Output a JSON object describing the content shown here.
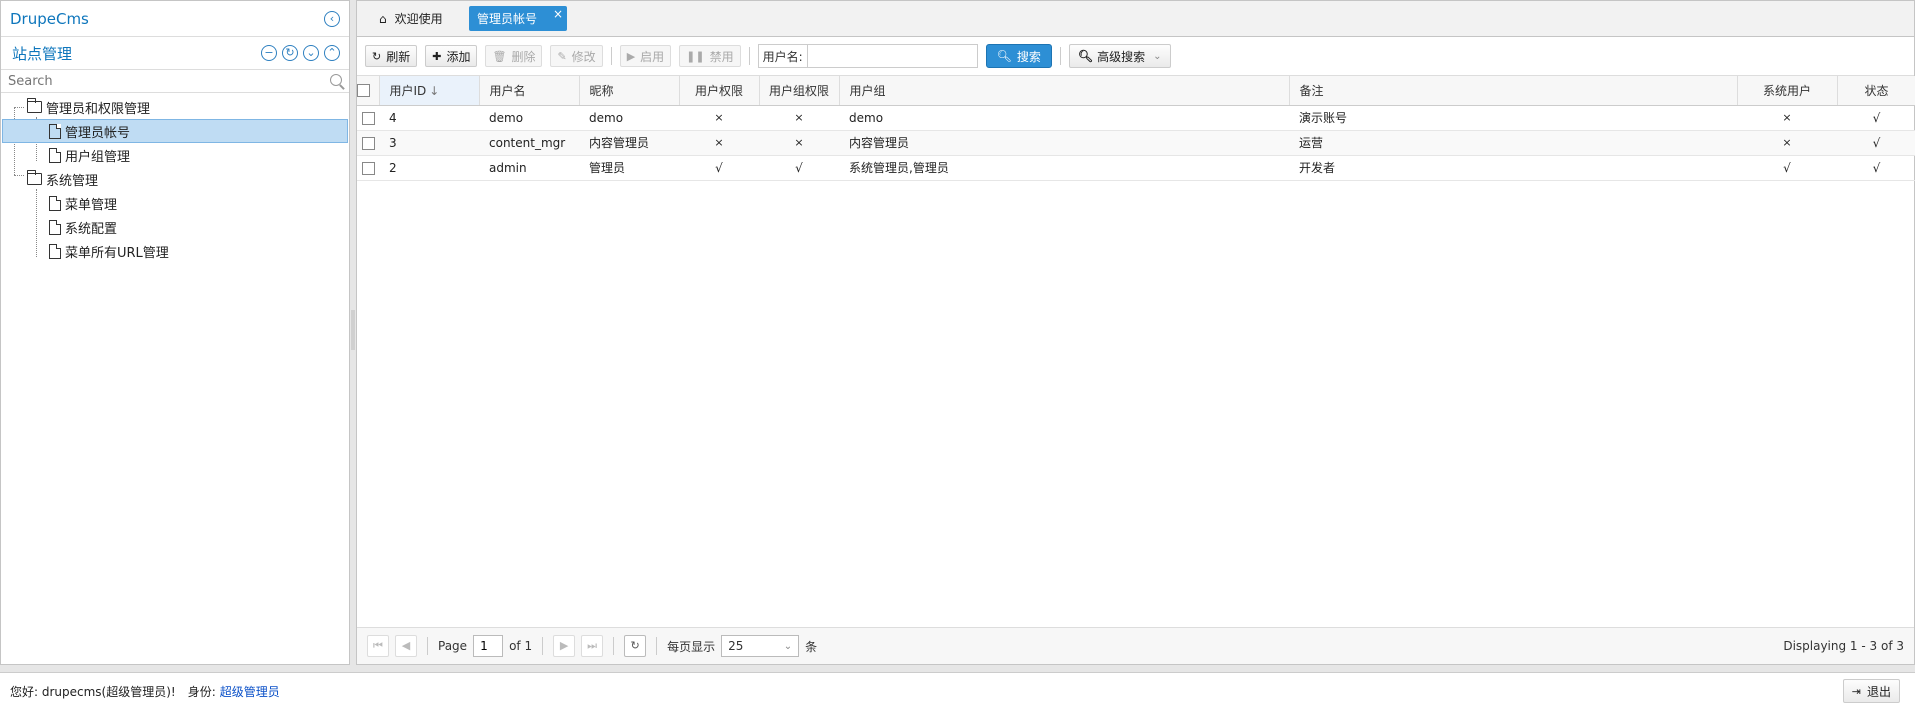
{
  "app": {
    "title": "DrupeCms"
  },
  "west": {
    "section_title": "站点管理",
    "search_placeholder": "Search",
    "tree": [
      {
        "label": "管理员和权限管理",
        "type": "folder",
        "level": 0
      },
      {
        "label": "管理员帐号",
        "type": "file",
        "level": 1,
        "selected": true
      },
      {
        "label": "用户组管理",
        "type": "file",
        "level": 1
      },
      {
        "label": "系统管理",
        "type": "folder",
        "level": 0
      },
      {
        "label": "菜单管理",
        "type": "file",
        "level": 1
      },
      {
        "label": "系统配置",
        "type": "file",
        "level": 1
      },
      {
        "label": "菜单所有URL管理",
        "type": "file",
        "level": 1
      }
    ]
  },
  "tabs": {
    "home": "欢迎使用",
    "active": "管理员帐号",
    "close": "×"
  },
  "toolbar": {
    "refresh": "刷新",
    "add": "添加",
    "delete": "删除",
    "edit": "修改",
    "enable": "启用",
    "disable": "禁用",
    "username_label": "用户名:",
    "username_value": "",
    "search": "搜索",
    "advanced_search": "高级搜索"
  },
  "grid": {
    "columns": {
      "id": "用户ID",
      "username": "用户名",
      "nickname": "昵称",
      "user_perm": "用户权限",
      "group_perm": "用户组权限",
      "groups": "用户组",
      "remark": "备注",
      "system_user": "系统用户",
      "status": "状态"
    },
    "rows": [
      {
        "id": "4",
        "username": "demo",
        "nickname": "demo",
        "user_perm": "×",
        "group_perm": "×",
        "groups": "demo",
        "remark": "演示账号",
        "system_user": "×",
        "status": "√"
      },
      {
        "id": "3",
        "username": "content_mgr",
        "nickname": "内容管理员",
        "user_perm": "×",
        "group_perm": "×",
        "groups": "内容管理员",
        "remark": "运营",
        "system_user": "×",
        "status": "√"
      },
      {
        "id": "2",
        "username": "admin",
        "nickname": "管理员",
        "user_perm": "√",
        "group_perm": "√",
        "groups": "系统管理员,管理员",
        "remark": "开发者",
        "system_user": "√",
        "status": "√"
      }
    ]
  },
  "pager": {
    "page_label": "Page",
    "page_value": "1",
    "of_label": "of 1",
    "per_page_label": "每页显示",
    "per_page_value": "25",
    "unit": "条",
    "info": "Displaying 1 - 3 of 3"
  },
  "footer": {
    "greeting": "您好: drupecms(超级管理员)!",
    "role_label": "身份:",
    "role_value": "超级管理员",
    "logout": "退出"
  },
  "colors": {
    "accent": "#2d8fd5",
    "link": "#0e76bc",
    "yes": "#1aa31a",
    "no": "#e03030"
  }
}
